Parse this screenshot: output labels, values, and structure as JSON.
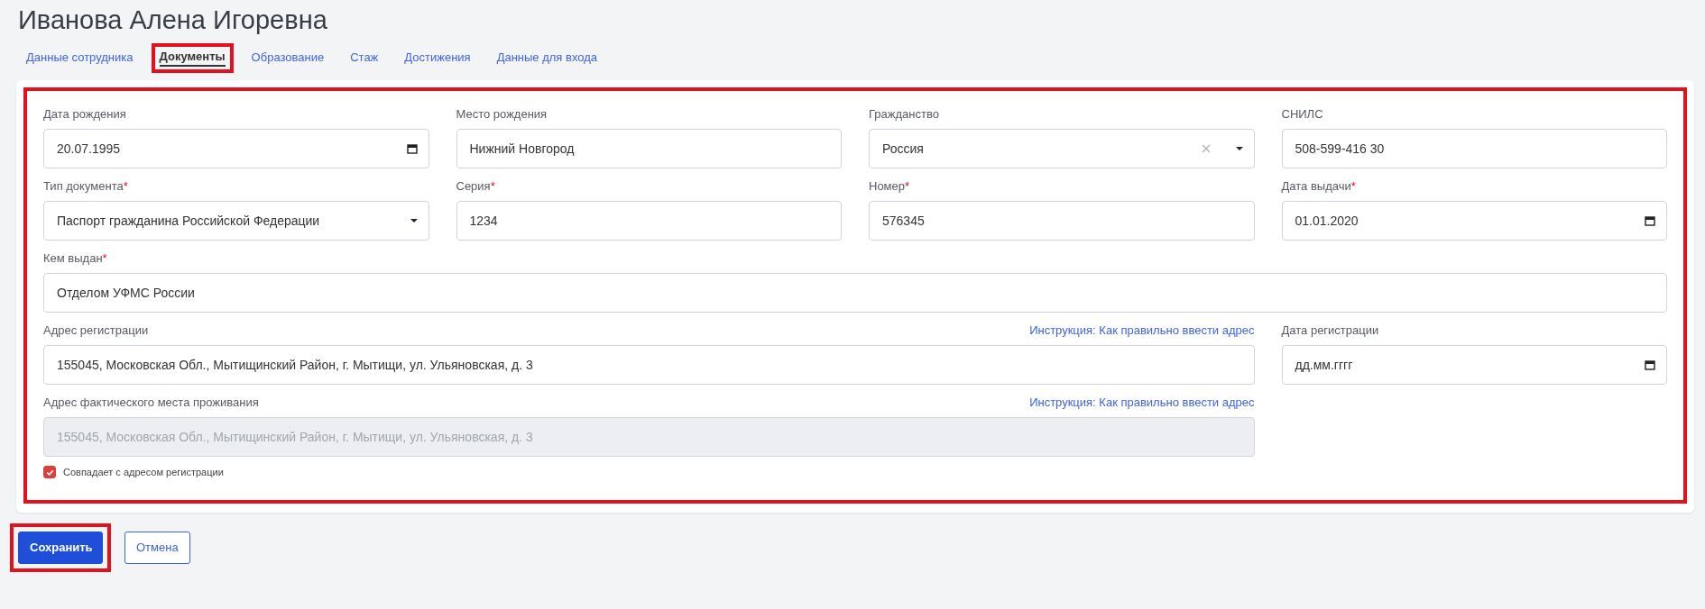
{
  "title": "Иванова Алена Игоревна",
  "tabs": [
    {
      "label": "Данные сотрудника",
      "selected": false,
      "highlighted": false
    },
    {
      "label": "Документы",
      "selected": true,
      "highlighted": true
    },
    {
      "label": "Образование",
      "selected": false,
      "highlighted": false
    },
    {
      "label": "Стаж",
      "selected": false,
      "highlighted": false
    },
    {
      "label": "Достижения",
      "selected": false,
      "highlighted": false
    },
    {
      "label": "Данные для входа",
      "selected": false,
      "highlighted": false
    }
  ],
  "form": {
    "highlighted": true,
    "fields": [
      {
        "label": "Дата рождения",
        "kind": "date",
        "value": "20.07.1995",
        "wide": false,
        "full_width": false,
        "disabled": false
      },
      {
        "label": "Место рождения",
        "kind": "text",
        "value": "Нижний Новгород",
        "wide": false,
        "full_width": false,
        "disabled": false
      },
      {
        "label": "Гражданство",
        "kind": "clearable-select",
        "value": "Россия",
        "wide": false,
        "full_width": false,
        "disabled": false
      },
      {
        "label": "СНИЛС",
        "kind": "text",
        "value": "508-599-416 30",
        "wide": false,
        "full_width": false,
        "disabled": false
      },
      {
        "label": "Тип документа",
        "required_mark": "*",
        "kind": "select",
        "value": "Паспорт гражданина Российской Федерации",
        "wide": false,
        "full_width": false,
        "disabled": false
      },
      {
        "label": "Серия",
        "required_mark": "*",
        "kind": "text",
        "value": "1234",
        "wide": false,
        "full_width": false,
        "disabled": false
      },
      {
        "label": "Номер",
        "required_mark": "*",
        "kind": "text",
        "value": "576345",
        "wide": false,
        "full_width": false,
        "disabled": false
      },
      {
        "label": "Дата выдачи",
        "required_mark": "*",
        "kind": "date",
        "value": "01.01.2020",
        "wide": false,
        "full_width": false,
        "disabled": false
      },
      {
        "label": "Кем выдан",
        "required_mark": "*",
        "kind": "text",
        "value": "Отделом УФМС России",
        "wide": true,
        "full_width": true,
        "disabled": false
      },
      {
        "label": "Адрес регистрации",
        "kind": "text",
        "value": "155045, Московская Обл., Мытищинский Район, г. Мытищи, ул. Ульяновская, д. 3",
        "wide": true,
        "full_width": false,
        "disabled": false,
        "link": "Инструкция: Как правильно ввести адрес"
      },
      {
        "label": "Дата регистрации",
        "kind": "date",
        "placeholder": "дд.мм.гггг",
        "wide": false,
        "full_width": false,
        "disabled": false
      },
      {
        "label": "Адрес фактического места проживания",
        "kind": "text",
        "value": "155045, Московская Обл., Мытищинский Район, г. Мытищи, ул. Ульяновская, д. 3",
        "wide": true,
        "full_width": false,
        "disabled": true,
        "link": "Инструкция: Как правильно ввести адрес"
      }
    ],
    "checkbox": {
      "label": "Совпадает с адресом регистрации",
      "checked": true
    }
  },
  "buttons": [
    {
      "label": "Сохранить",
      "kind": "primary",
      "highlighted": true
    },
    {
      "label": "Отмена",
      "kind": "secondary",
      "highlighted": false
    }
  ]
}
